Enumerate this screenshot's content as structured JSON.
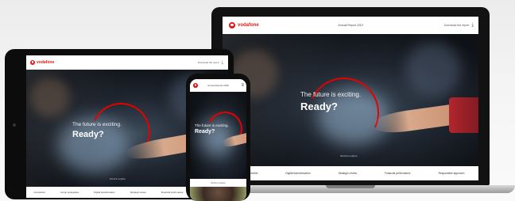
{
  "brand": {
    "name": "vodafone",
    "accent": "#e60000"
  },
  "laptop": {
    "header_title": "Annual Report 2019",
    "header_download": "Download the report",
    "hero_tagline": "The future is exciting.",
    "hero_headline": "Ready?",
    "scroll_hint": "Scroll to explore",
    "nav": [
      "Group perspective",
      "Digital transformation",
      "Strategic review",
      "Financial performance",
      "Responsible approach"
    ]
  },
  "tablet": {
    "header_download": "Download the report",
    "hero_tagline": "The future is exciting.",
    "hero_headline": "Ready?",
    "scroll_hint": "Scroll to explore",
    "nav": [
      "Introduction",
      "Group perspective",
      "Digital transformation",
      "Strategic review",
      "Financial performance",
      "Responsible approach"
    ]
  },
  "phone": {
    "header_title": "Annual Report 2019",
    "hero_tagline": "The future is exciting.",
    "hero_headline": "Ready?",
    "scroll_hint": "Scroll to explore"
  },
  "icons": {
    "download": "download-icon",
    "menu": "hamburger-menu-icon",
    "logo": "vodafone-speechmark-logo"
  }
}
